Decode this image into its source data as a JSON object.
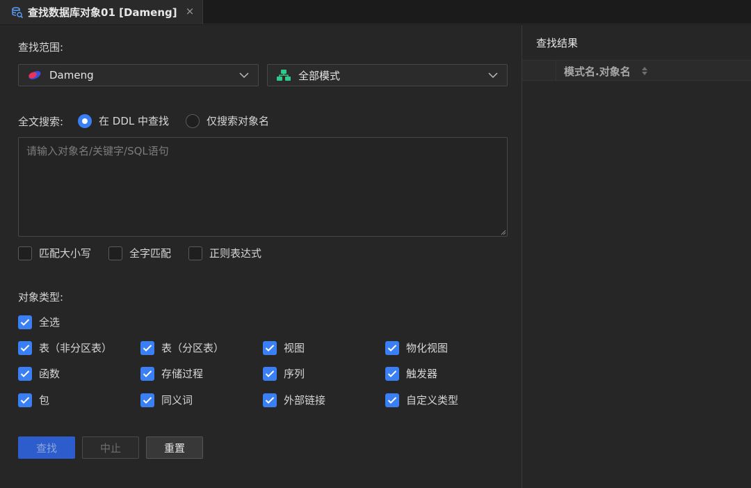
{
  "tab": {
    "title": "查找数据库对象01 [Dameng]",
    "close": "×",
    "icon": "database-search-icon"
  },
  "search_scope": {
    "label": "查找范围:",
    "datasource": {
      "value": "Dameng",
      "icon": "dameng-logo-icon"
    },
    "schema": {
      "value": "全部模式",
      "icon": "schema-tree-icon"
    }
  },
  "fulltext": {
    "label": "全文搜索:",
    "options": [
      {
        "label": "在 DDL 中查找",
        "selected": true
      },
      {
        "label": "仅搜索对象名",
        "selected": false
      }
    ]
  },
  "query": {
    "placeholder": "请输入对象名/关键字/SQL语句",
    "value": ""
  },
  "match_options": [
    {
      "label": "匹配大小写",
      "checked": false
    },
    {
      "label": "全字匹配",
      "checked": false
    },
    {
      "label": "正则表达式",
      "checked": false
    }
  ],
  "object_types": {
    "label": "对象类型:",
    "select_all": {
      "label": "全选",
      "checked": true
    },
    "items": [
      {
        "label": "表（非分区表）",
        "checked": true
      },
      {
        "label": "表（分区表）",
        "checked": true
      },
      {
        "label": "视图",
        "checked": true
      },
      {
        "label": "物化视图",
        "checked": true
      },
      {
        "label": "函数",
        "checked": true
      },
      {
        "label": "存储过程",
        "checked": true
      },
      {
        "label": "序列",
        "checked": true
      },
      {
        "label": "触发器",
        "checked": true
      },
      {
        "label": "包",
        "checked": true
      },
      {
        "label": "同义词",
        "checked": true
      },
      {
        "label": "外部链接",
        "checked": true
      },
      {
        "label": "自定义类型",
        "checked": true
      }
    ]
  },
  "buttons": {
    "search": "查找",
    "stop": "中止",
    "reset": "重置"
  },
  "results": {
    "title": "查找结果",
    "column": "模式名.对象名"
  },
  "colors": {
    "accent": "#3b7ff5",
    "primary_button": "#2d5ccd",
    "schema_icon": "#2fc98a",
    "dameng_red": "#e8345a",
    "dameng_blue": "#3a4ee0"
  }
}
